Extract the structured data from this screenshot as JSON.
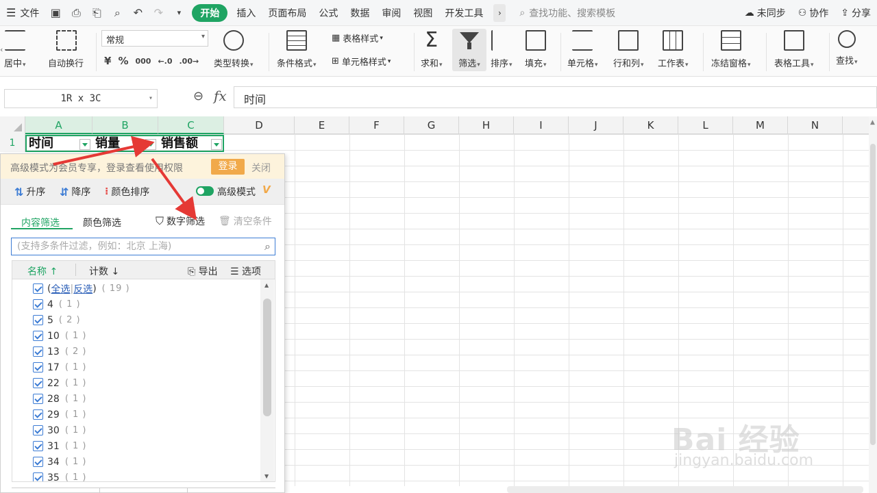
{
  "menubar": {
    "file_label": "文件",
    "tabs": [
      "开始",
      "插入",
      "页面布局",
      "公式",
      "数据",
      "审阅",
      "视图",
      "开发工具"
    ],
    "active_tab": "开始",
    "search_placeholder": "查找功能、搜索模板",
    "right": [
      "未同步",
      "协作",
      "分享"
    ]
  },
  "ribbon": {
    "merge_label": "居中",
    "autowrap_label": "自动换行",
    "number_format_value": "常规",
    "number_format_buttons": [
      "¥",
      "%",
      "000",
      "←.0",
      ".00→"
    ],
    "type_convert_label": "类型转换",
    "conditional_label": "条件格式",
    "table_style_label": "表格样式",
    "cell_style_label": "单元格样式",
    "sum_label": "求和",
    "filter_label": "筛选",
    "sort_label": "排序",
    "fill_label": "填充",
    "cell_label": "单元格",
    "rowcol_label": "行和列",
    "sheet_label": "工作表",
    "freeze_label": "冻结窗格",
    "tools_label": "表格工具",
    "find_label": "查找"
  },
  "formula": {
    "name_box": "1R x 3C",
    "fx": "fx",
    "value": "时间"
  },
  "grid": {
    "columns": [
      "A",
      "B",
      "C",
      "D",
      "E",
      "F",
      "G",
      "H",
      "I",
      "J",
      "K",
      "L",
      "M",
      "N"
    ],
    "row_number": "1",
    "row1": [
      "时间",
      "销量",
      "销售额"
    ]
  },
  "filter_panel": {
    "banner_text": "高级模式为会员专享，登录查看使用权限",
    "login_button": "登录",
    "close_button": "关闭",
    "sort_asc": "升序",
    "sort_desc": "降序",
    "color_sort": "颜色排序",
    "advanced_mode": "高级模式",
    "vip_badge": "V",
    "tab_content": "内容筛选",
    "tab_color": "颜色筛选",
    "number_filter": "数字筛选",
    "clear_conditions": "清空条件",
    "search_placeholder": "(支持多条件过滤，例如：北京 上海)",
    "col_name": "名称",
    "col_count": "计数",
    "export_label": "导出",
    "options_label": "选项",
    "select_all_open": "(",
    "select_all": "全选",
    "invert": "反选",
    "select_all_close": ")",
    "select_all_count": "( 19 )",
    "items": [
      {
        "value": "4",
        "count": "( 1 )"
      },
      {
        "value": "5",
        "count": "( 2 )"
      },
      {
        "value": "10",
        "count": "( 1 )"
      },
      {
        "value": "13",
        "count": "( 2 )"
      },
      {
        "value": "17",
        "count": "( 1 )"
      },
      {
        "value": "22",
        "count": "( 1 )"
      },
      {
        "value": "28",
        "count": "( 1 )"
      },
      {
        "value": "29",
        "count": "( 1 )"
      },
      {
        "value": "30",
        "count": "( 1 )"
      },
      {
        "value": "31",
        "count": "( 1 )"
      },
      {
        "value": "34",
        "count": "( 1 )"
      },
      {
        "value": "35",
        "count": "( 1 )"
      }
    ]
  },
  "watermark": {
    "brand": "Bai 经验",
    "url": "jingyan.baidu.com"
  },
  "colors": {
    "accent": "#1fa463",
    "banner_bg": "#fdf3dc",
    "login": "#f1a94a",
    "arrow": "#e53935"
  }
}
